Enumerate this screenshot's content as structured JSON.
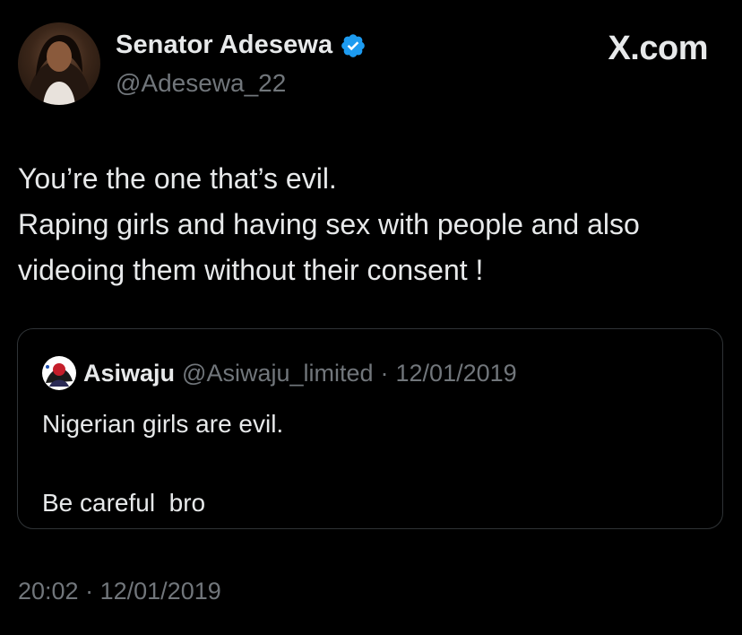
{
  "author": {
    "display_name": "Senator Adesewa",
    "handle": "@Adesewa_22",
    "verified": true,
    "avatar_icon": "profile-photo",
    "verified_icon": "verified-badge-icon"
  },
  "brand": {
    "label": "X.com"
  },
  "tweet": {
    "lines": [
      "You’re the one that’s evil.",
      "Raping girls and having sex with people and also",
      "videoing them without their consent !"
    ]
  },
  "quoted_tweet": {
    "display_name": "Asiwaju",
    "handle": "@Asiwaju_limited",
    "separator": "·",
    "date": "12/01/2019",
    "avatar_icon": "profile-photo",
    "lines": [
      "Nigerian girls are evil.",
      "Be careful  bro"
    ]
  },
  "footer": {
    "time": "20:02",
    "separator": "·",
    "date": "12/01/2019"
  },
  "colors": {
    "background": "#000000",
    "primary_text": "#e7e9ea",
    "secondary_text": "#71767b",
    "verified_blue": "#1d9bf0",
    "card_border": "#2f3336"
  }
}
